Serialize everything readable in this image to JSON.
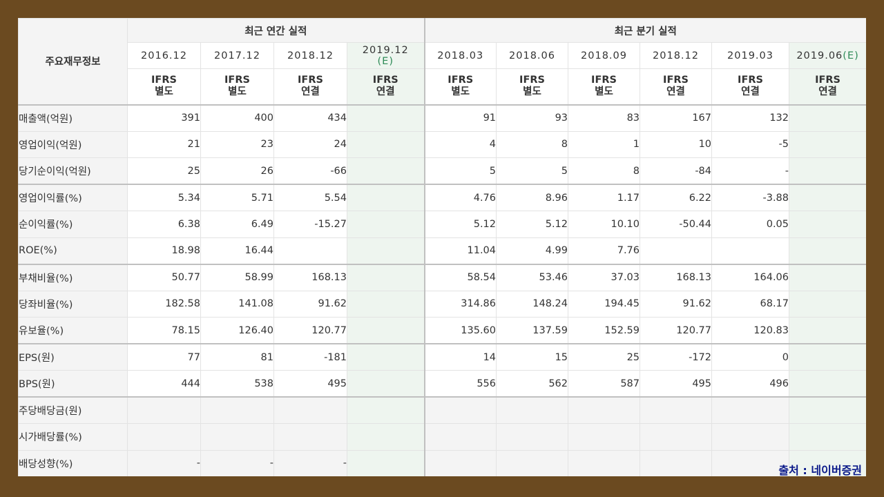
{
  "header": {
    "corner_label": "주요재무정보",
    "annual_group": "최근 연간 실적",
    "quarter_group": "최근 분기 실적",
    "periods": [
      {
        "label": "2016.12",
        "est": "",
        "basis1": "IFRS",
        "basis2": "별도"
      },
      {
        "label": "2017.12",
        "est": "",
        "basis1": "IFRS",
        "basis2": "별도"
      },
      {
        "label": "2018.12",
        "est": "",
        "basis1": "IFRS",
        "basis2": "연결"
      },
      {
        "label": "2019.12",
        "est": "(E)",
        "basis1": "IFRS",
        "basis2": "연결"
      },
      {
        "label": "2018.03",
        "est": "",
        "basis1": "IFRS",
        "basis2": "별도"
      },
      {
        "label": "2018.06",
        "est": "",
        "basis1": "IFRS",
        "basis2": "별도"
      },
      {
        "label": "2018.09",
        "est": "",
        "basis1": "IFRS",
        "basis2": "별도"
      },
      {
        "label": "2018.12",
        "est": "",
        "basis1": "IFRS",
        "basis2": "연결"
      },
      {
        "label": "2019.03",
        "est": "",
        "basis1": "IFRS",
        "basis2": "연결"
      },
      {
        "label": "2019.06",
        "est": "(E)",
        "basis1": "IFRS",
        "basis2": "연결"
      }
    ]
  },
  "rows": [
    {
      "label": "매출액(억원)",
      "values": [
        "391",
        "400",
        "434",
        "",
        "91",
        "93",
        "83",
        "167",
        "132",
        ""
      ]
    },
    {
      "label": "영업이익(억원)",
      "values": [
        "21",
        "23",
        "24",
        "",
        "4",
        "8",
        "1",
        "10",
        "-5",
        ""
      ]
    },
    {
      "label": "당기순이익(억원)",
      "values": [
        "25",
        "26",
        "-66",
        "",
        "5",
        "5",
        "8",
        "-84",
        "-",
        ""
      ]
    },
    {
      "label": "영업이익률(%)",
      "values": [
        "5.34",
        "5.71",
        "5.54",
        "",
        "4.76",
        "8.96",
        "1.17",
        "6.22",
        "-3.88",
        ""
      ]
    },
    {
      "label": "순이익률(%)",
      "values": [
        "6.38",
        "6.49",
        "-15.27",
        "",
        "5.12",
        "5.12",
        "10.10",
        "-50.44",
        "0.05",
        ""
      ]
    },
    {
      "label": "ROE(%)",
      "values": [
        "18.98",
        "16.44",
        "",
        "",
        "11.04",
        "4.99",
        "7.76",
        "",
        "",
        ""
      ]
    },
    {
      "label": "부채비율(%)",
      "values": [
        "50.77",
        "58.99",
        "168.13",
        "",
        "58.54",
        "53.46",
        "37.03",
        "168.13",
        "164.06",
        ""
      ]
    },
    {
      "label": "당좌비율(%)",
      "values": [
        "182.58",
        "141.08",
        "91.62",
        "",
        "314.86",
        "148.24",
        "194.45",
        "91.62",
        "68.17",
        ""
      ]
    },
    {
      "label": "유보율(%)",
      "values": [
        "78.15",
        "126.40",
        "120.77",
        "",
        "135.60",
        "137.59",
        "152.59",
        "120.77",
        "120.83",
        ""
      ]
    },
    {
      "label": "EPS(원)",
      "values": [
        "77",
        "81",
        "-181",
        "",
        "14",
        "15",
        "25",
        "-172",
        "0",
        ""
      ]
    },
    {
      "label": "BPS(원)",
      "values": [
        "444",
        "538",
        "495",
        "",
        "556",
        "562",
        "587",
        "495",
        "496",
        ""
      ]
    },
    {
      "label": "주당배당금(원)",
      "values": [
        "",
        "",
        "",
        "",
        "",
        "",
        "",
        "",
        "",
        ""
      ]
    },
    {
      "label": "시가배당률(%)",
      "values": [
        "",
        "",
        "",
        "",
        "",
        "",
        "",
        "",
        "",
        ""
      ]
    },
    {
      "label": "배당성향(%)",
      "values": [
        "-",
        "-",
        "-",
        "",
        "",
        "",
        "",
        "",
        "",
        ""
      ]
    }
  ],
  "source": "출처 : 네이버증권",
  "colors": {
    "negative": "#e00000",
    "basis": "#e46c0a",
    "estimate_bg": "#eef5ef",
    "estimate_mark": "#2e8b57"
  }
}
